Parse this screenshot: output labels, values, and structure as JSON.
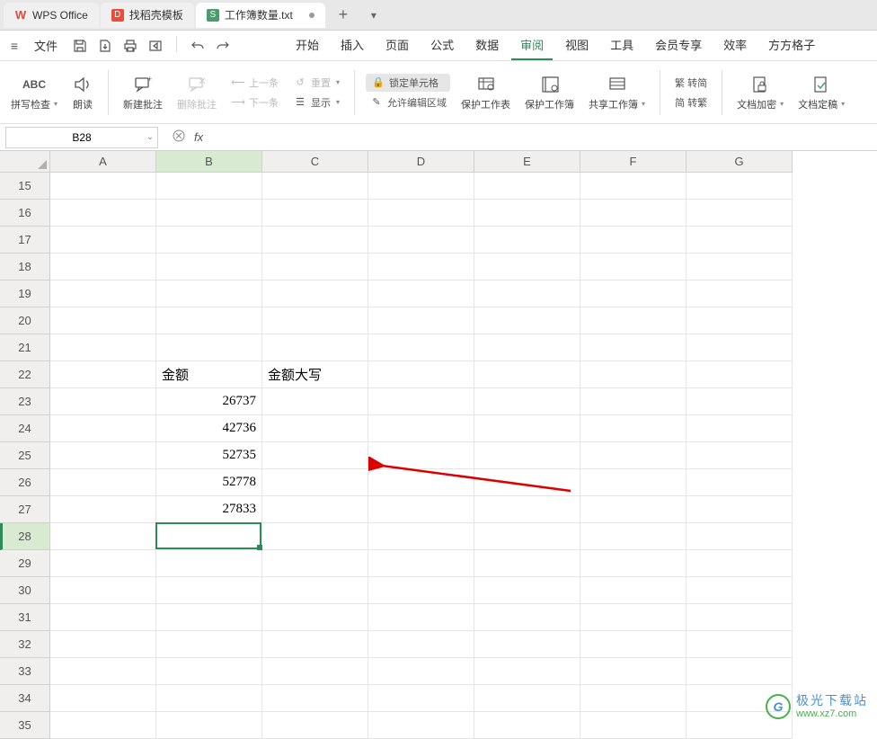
{
  "tabs": {
    "t1": "WPS Office",
    "t2": "找稻壳模板",
    "t3": "工作簿数量.txt"
  },
  "menu": {
    "file": "文件",
    "items": [
      "开始",
      "插入",
      "页面",
      "公式",
      "数据",
      "审阅",
      "视图",
      "工具",
      "会员专享",
      "效率",
      "方方格子"
    ]
  },
  "ribbon": {
    "spellcheck_top": "ABC",
    "spellcheck": "拼写检查",
    "read": "朗读",
    "new_comment": "新建批注",
    "del_comment": "删除批注",
    "prev": "上一条",
    "reset": "重置",
    "next": "下一条",
    "show": "显示",
    "lock_cell": "锁定单元格",
    "allow_edit": "允许编辑区域",
    "protect_sheet": "保护工作表",
    "protect_book": "保护工作簿",
    "share_book": "共享工作簿",
    "to_simp": "繁 转简",
    "to_trad": "简 转繁",
    "encrypt": "文档加密",
    "finalize": "文档定稿"
  },
  "formula": {
    "cell_ref": "B28",
    "fx": "fx"
  },
  "columns": [
    "A",
    "B",
    "C",
    "D",
    "E",
    "F",
    "G"
  ],
  "row_start": 15,
  "row_end": 35,
  "selected_row": 28,
  "selected_col_idx": 1,
  "cells": {
    "B22": "金额",
    "C22": "金额大写",
    "B23": "26737",
    "B24": "42736",
    "B25": "52735",
    "B26": "52778",
    "B27": "27833"
  },
  "watermark": {
    "cn": "极光下载站",
    "url": "www.xz7.com",
    "logo": "G"
  }
}
